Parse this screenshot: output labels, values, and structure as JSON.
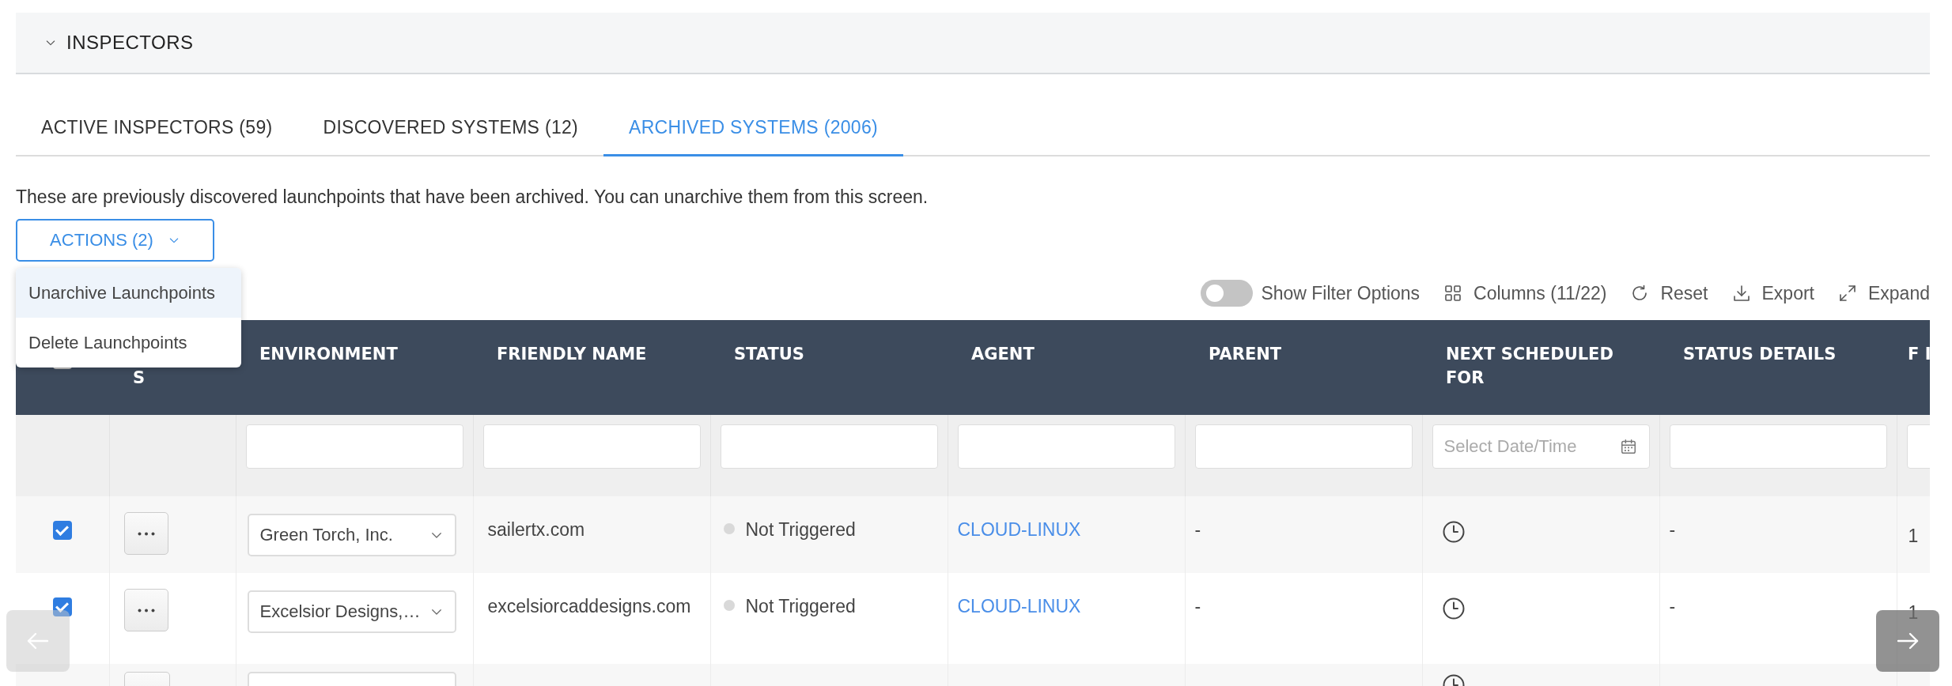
{
  "section": {
    "title": "INSPECTORS",
    "expanded": true
  },
  "tabs": [
    {
      "label": "ACTIVE INSPECTORS (59)",
      "selected": false
    },
    {
      "label": "DISCOVERED SYSTEMS (12)",
      "selected": false
    },
    {
      "label": "ARCHIVED SYSTEMS (2006)",
      "selected": true
    }
  ],
  "description": "These are previously discovered launchpoints that have been archived. You can unarchive them from this screen.",
  "actions_button": {
    "label": "ACTIONS (2)"
  },
  "actions_menu": [
    {
      "label": "Unarchive Launchpoints",
      "highlighted": true
    },
    {
      "label": "Delete Launchpoints",
      "highlighted": false
    }
  ],
  "toolbar": {
    "filter_toggle": {
      "label": "Show Filter Options",
      "on": false
    },
    "buttons": [
      {
        "kind": "columns",
        "label": "Columns (11/22)"
      },
      {
        "kind": "reset",
        "label": "Reset"
      },
      {
        "kind": "export",
        "label": "Export"
      },
      {
        "kind": "expand",
        "label": "Expand"
      }
    ]
  },
  "table": {
    "select_all_checked": false,
    "columns": [
      {
        "kind": "select"
      },
      {
        "kind": "actions",
        "label": "S"
      },
      {
        "kind": "environment",
        "label": "ENVIRONMENT"
      },
      {
        "kind": "friendly_name",
        "label": "FRIENDLY NAME"
      },
      {
        "kind": "status",
        "label": "STATUS"
      },
      {
        "kind": "agent",
        "label": "AGENT"
      },
      {
        "kind": "parent",
        "label": "PARENT"
      },
      {
        "kind": "next_scheduled",
        "label": "NEXT SCHEDULED FOR",
        "placeholder": "Select Date/Time"
      },
      {
        "kind": "status_details",
        "label": "STATUS DETAILS"
      },
      {
        "kind": "column_10",
        "label": "F I"
      }
    ],
    "rows": [
      {
        "checked": true,
        "environment": "Green Torch, Inc.",
        "friendly_name": "sailertx.com",
        "status": "Not Triggered",
        "agent": "CLOUD-LINUX",
        "parent": "-",
        "status_details": "-",
        "column_10": "1"
      },
      {
        "checked": true,
        "environment": "Excelsior Designs,…",
        "friendly_name": "excelsiorcaddesigns.com",
        "status": "Not Triggered",
        "agent": "CLOUD-LINUX",
        "parent": "-",
        "status_details": "-",
        "column_10": "1"
      },
      {
        "cut_off": true
      }
    ]
  },
  "pager": {
    "prev_disabled": true,
    "next_disabled": false
  }
}
